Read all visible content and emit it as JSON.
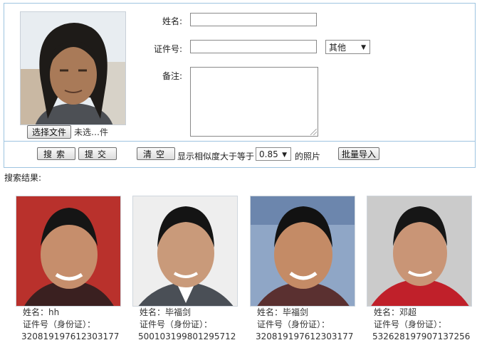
{
  "form": {
    "name_label": "姓名:",
    "name_value": "",
    "id_label": "证件号:",
    "id_value": "",
    "id_type_selected": "其他",
    "note_label": "备注:",
    "note_value": "",
    "file_button": "选择文件",
    "file_status": "未选…件"
  },
  "actions": {
    "search": "搜索",
    "submit": "提交",
    "clear": "清空",
    "similarity_prefix": "显示相似度大于等于",
    "similarity_value": "0.85",
    "similarity_suffix": "的照片",
    "batch_import": "批量导入"
  },
  "results": {
    "title": "搜索结果:",
    "items": [
      {
        "name_label": "姓名：",
        "name": "hh",
        "id_label": "证件号（身份证）：",
        "id_number": "320819197612303177",
        "bg": "#b9312c"
      },
      {
        "name_label": "姓名：",
        "name": "毕福剑",
        "id_label": "证件号（身份证）：",
        "id_number": "500103199801295712",
        "bg": "#e9e9e9"
      },
      {
        "name_label": "姓名：",
        "name": "毕福剑",
        "id_label": "证件号（身份证）：",
        "id_number": "320819197612303177",
        "bg": "#8fa6c6"
      },
      {
        "name_label": "姓名：",
        "name": "邓超",
        "id_label": "证件号（身份证）：",
        "id_number": "532628197907137256",
        "bg": "#cbcbcb"
      }
    ]
  }
}
